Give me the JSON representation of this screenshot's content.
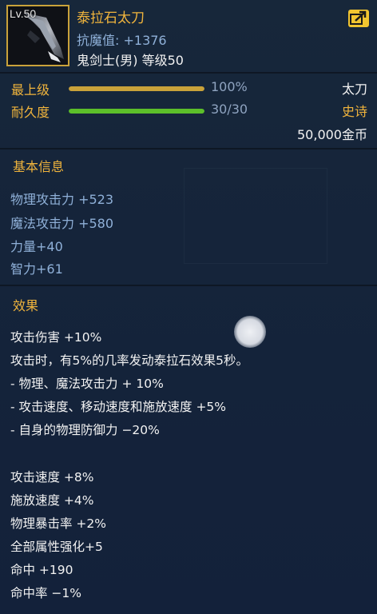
{
  "item": {
    "level_tag": "Lv.50",
    "name": "泰拉石太刀",
    "resist": "抗魔值: +1376",
    "class_level": "鬼剑士(男) 等级50",
    "weapon_type": "太刀",
    "rarity": "史诗",
    "price": "50,000金币"
  },
  "bars": [
    {
      "label": "最上级",
      "value_text": "100%",
      "fraction": 1.0,
      "color": "#c9a23a"
    },
    {
      "label": "耐久度",
      "value_text": "30/30",
      "fraction": 1.0,
      "color": "#5cbf2a"
    }
  ],
  "basic": {
    "title": "基本信息",
    "stats": [
      "物理攻击力 +523",
      "魔法攻击力 +580",
      "力量+40",
      "智力+61"
    ]
  },
  "effects": {
    "title": "效果",
    "lines": [
      "攻击伤害 +10%",
      "攻击时，有5%的几率发动泰拉石效果5秒。",
      " - 物理、魔法攻击力 + 10%",
      " - 攻击速度、移动速度和施放速度 +5%",
      " - 自身的物理防御力 −20%"
    ],
    "extra_lines": [
      "攻击速度 +8%",
      "施放速度 +4%",
      "物理暴击率 +2%",
      "全部属性强化+5",
      "命中 +190",
      "命中率 −1%"
    ]
  },
  "icons": {
    "share": "share-arrow-icon",
    "weapon": "sword-icon"
  }
}
